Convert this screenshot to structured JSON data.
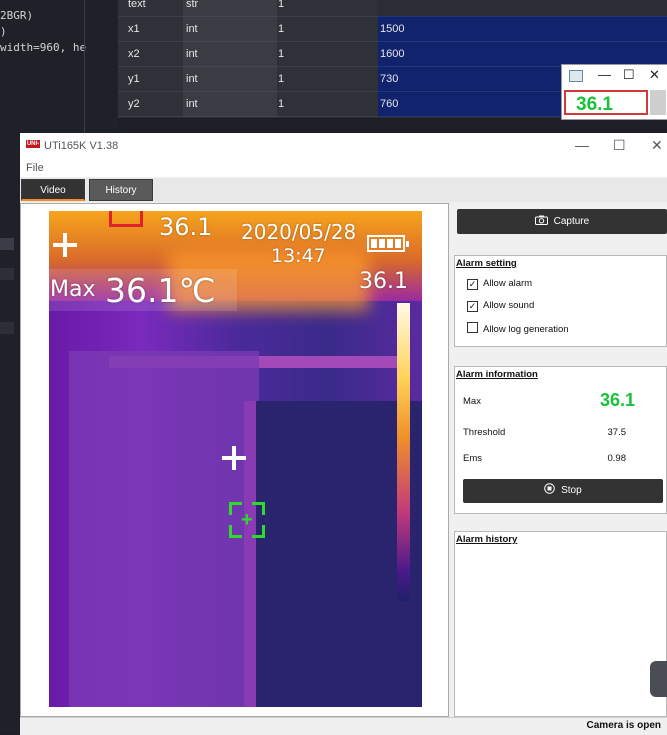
{
  "editor": {
    "lines": [
      "2BGR)",
      ")",
      "width=960, he"
    ]
  },
  "var_table": {
    "rows": [
      {
        "name": "text",
        "type": "str",
        "size": "1",
        "value": ""
      },
      {
        "name": "x1",
        "type": "int",
        "size": "1",
        "value": "1500"
      },
      {
        "name": "x2",
        "type": "int",
        "size": "1",
        "value": "1600"
      },
      {
        "name": "y1",
        "type": "int",
        "size": "1",
        "value": "730"
      },
      {
        "name": "y2",
        "type": "int",
        "size": "1",
        "value": "760"
      }
    ]
  },
  "mini_window": {
    "minimize": "—",
    "maximize": "☐",
    "close": "✕",
    "readout": "36.1",
    "readout_color": "#19c23a",
    "border_color": "#d23a3a"
  },
  "app": {
    "logo_text": "UNI-T",
    "title": "UTi165K V1.38",
    "window_minimize": "—",
    "window_maximize": "☐",
    "window_close": "✕",
    "menu_file": "File",
    "tabs": [
      {
        "label": "Video",
        "active": true
      },
      {
        "label": "History",
        "active": false
      }
    ],
    "accent_color": "#f08a2a"
  },
  "thermal": {
    "top_value": "36.1",
    "date": "2020/05/28",
    "time": "13:47",
    "max_label": "Max",
    "max_value": "36.1℃",
    "scale_value": "36.1",
    "target_color": "#2cdc2c"
  },
  "panel": {
    "capture_icon": "camera-icon",
    "capture_label": "Capture",
    "alarm_setting": {
      "title": "Alarm setting",
      "options": [
        {
          "label": "Allow alarm",
          "checked": true
        },
        {
          "label": "Allow sound",
          "checked": true
        },
        {
          "label": "Allow log generation",
          "checked": false
        }
      ]
    },
    "alarm_information": {
      "title": "Alarm information",
      "max_label": "Max",
      "max_value": "36.1",
      "max_color": "#19c23a",
      "threshold_label": "Threshold",
      "threshold_value": "37.5",
      "ems_label": "Ems",
      "ems_value": "0.98",
      "stop_icon": "stop-icon",
      "stop_label": "Stop"
    },
    "alarm_history": {
      "title": "Alarm history"
    }
  },
  "status": {
    "text": "Camera is open"
  }
}
